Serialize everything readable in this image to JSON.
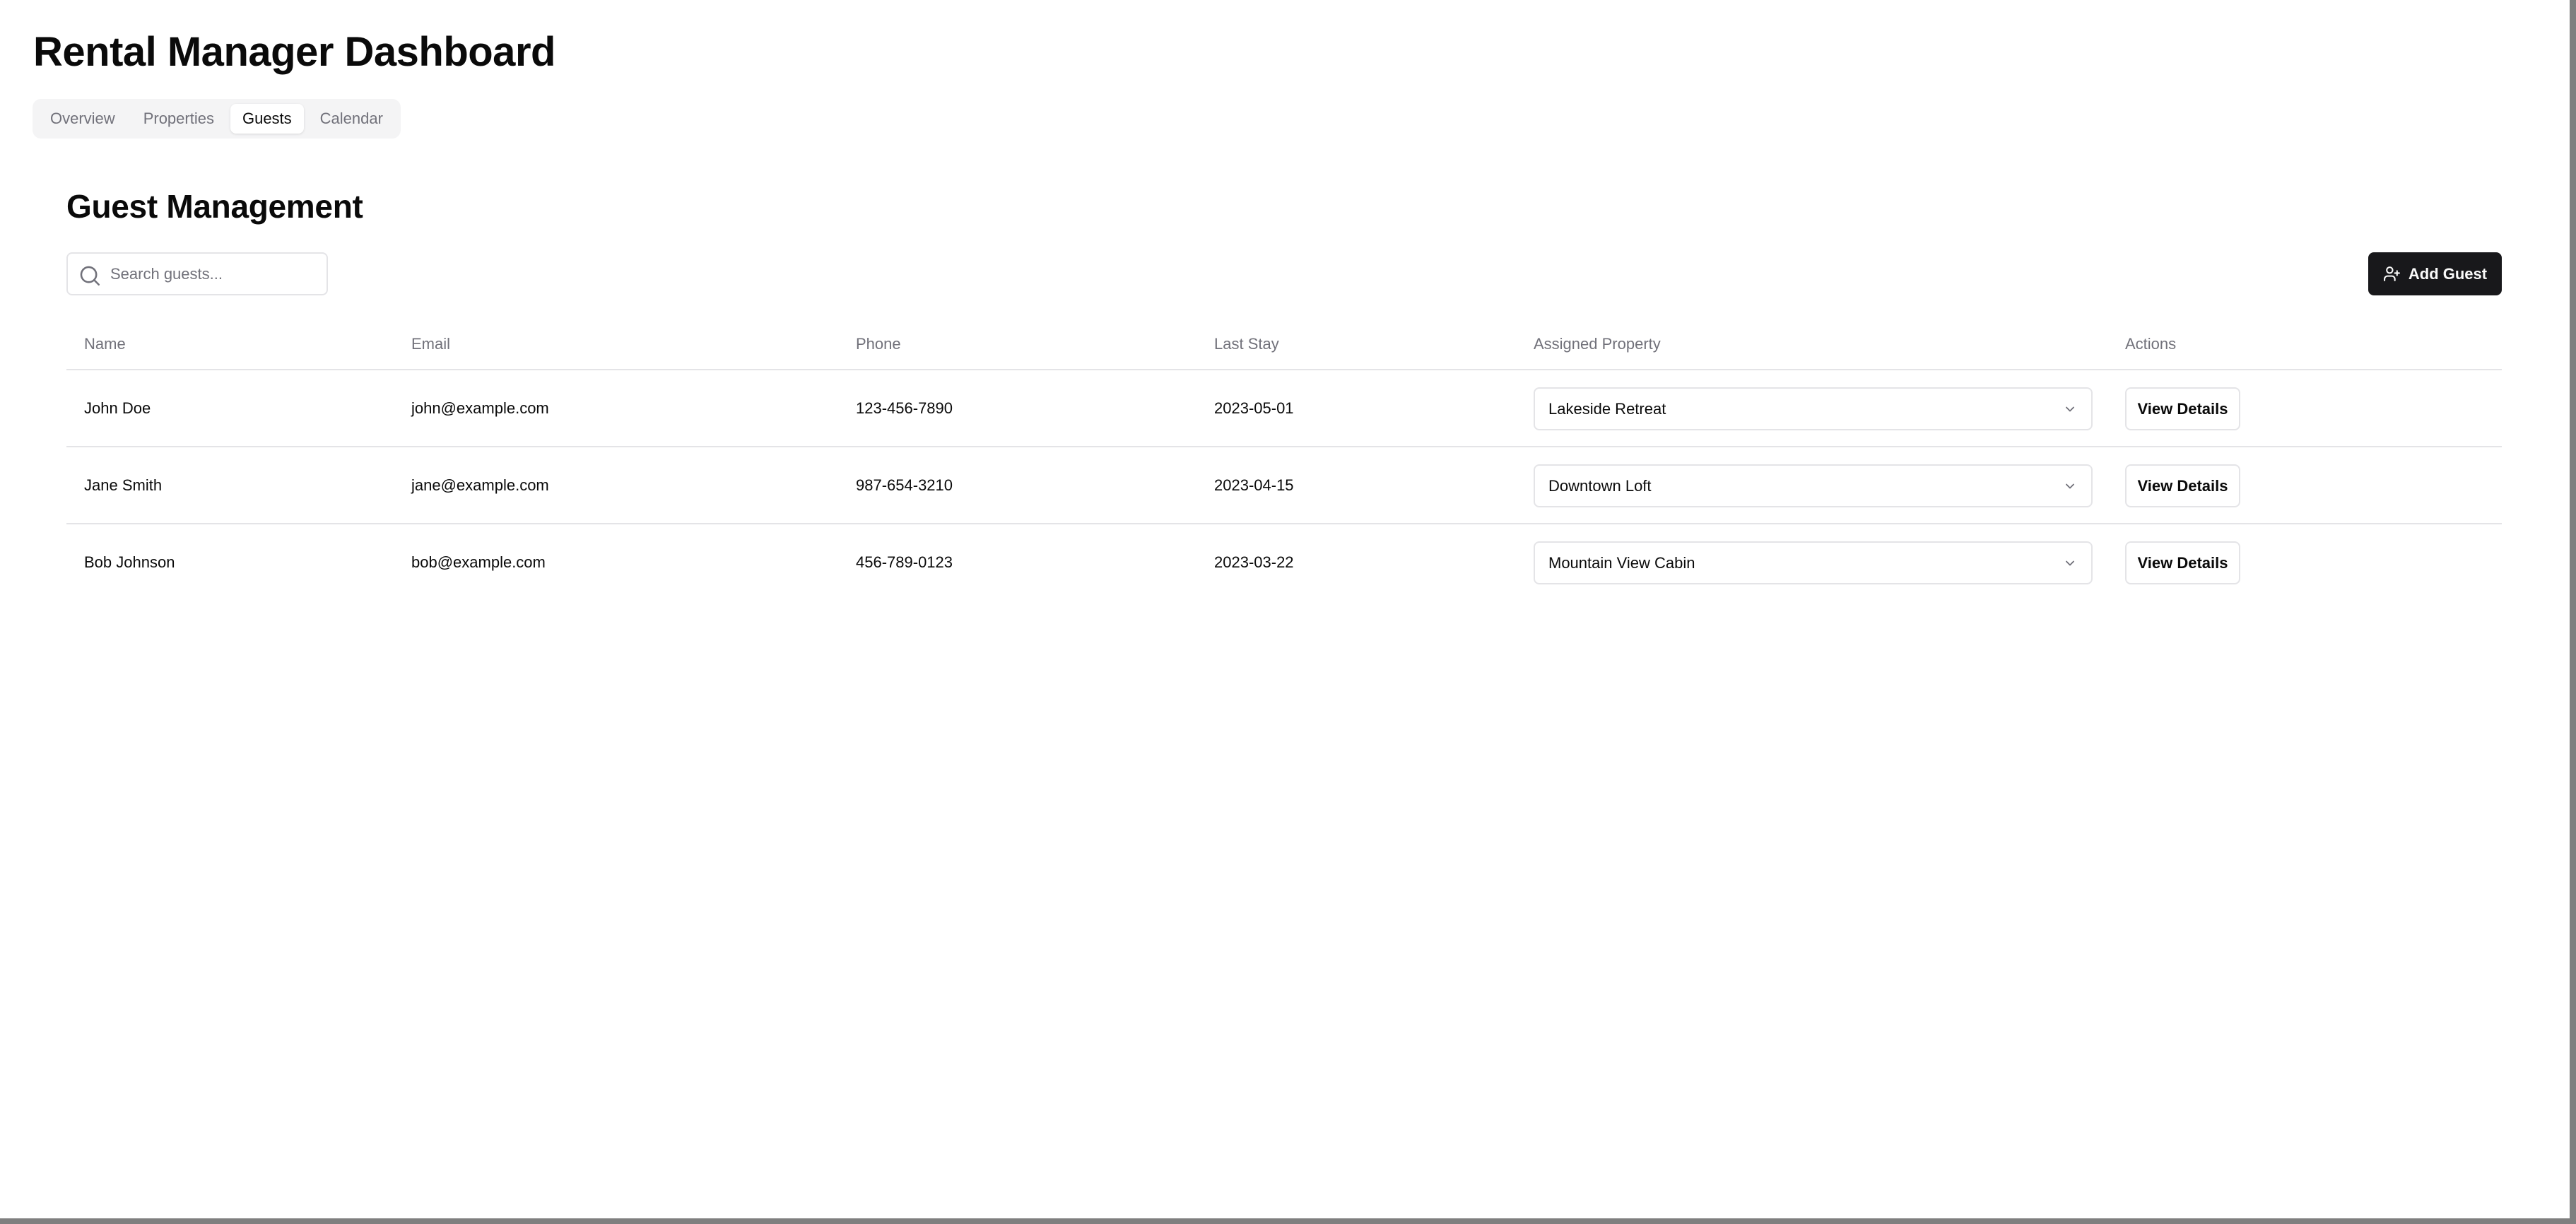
{
  "app": {
    "title": "Rental Manager Dashboard"
  },
  "tabs": [
    {
      "label": "Overview",
      "active": false
    },
    {
      "label": "Properties",
      "active": false
    },
    {
      "label": "Guests",
      "active": true
    },
    {
      "label": "Calendar",
      "active": false
    }
  ],
  "guests_section": {
    "title": "Guest Management",
    "search": {
      "placeholder": "Search guests...",
      "value": "",
      "icon": "search-icon"
    },
    "add_button": {
      "label": "Add Guest",
      "icon": "user-plus-icon"
    }
  },
  "table": {
    "columns": [
      "Name",
      "Email",
      "Phone",
      "Last Stay",
      "Assigned Property",
      "Actions"
    ],
    "rows": [
      {
        "name": "John Doe",
        "email": "john@example.com",
        "phone": "123-456-7890",
        "last_stay": "2023-05-01",
        "assigned_property": "Lakeside Retreat",
        "action_label": "View Details"
      },
      {
        "name": "Jane Smith",
        "email": "jane@example.com",
        "phone": "987-654-3210",
        "last_stay": "2023-04-15",
        "assigned_property": "Downtown Loft",
        "action_label": "View Details"
      },
      {
        "name": "Bob Johnson",
        "email": "bob@example.com",
        "phone": "456-789-0123",
        "last_stay": "2023-03-22",
        "assigned_property": "Mountain View Cabin",
        "action_label": "View Details"
      }
    ]
  },
  "colors": {
    "primary_button": "#18181b",
    "tab_bar_bg": "#f4f4f5",
    "muted_text": "#71717a",
    "border": "#e4e4e7"
  }
}
